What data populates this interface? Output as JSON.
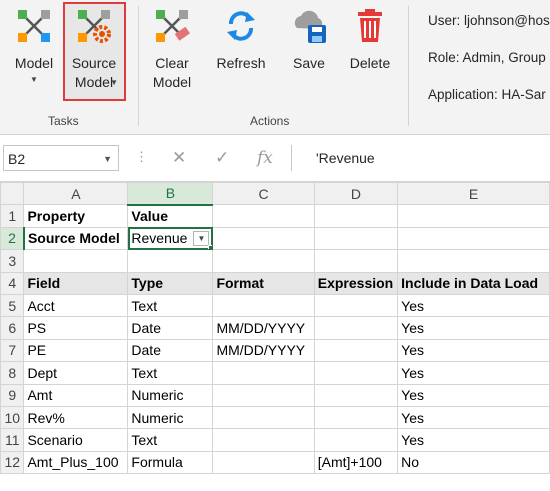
{
  "ribbon": {
    "buttons": [
      {
        "id": "model",
        "lines": [
          "Model"
        ],
        "caret": true
      },
      {
        "id": "source_model",
        "lines": [
          "Source",
          "Model"
        ],
        "caret": true
      },
      {
        "id": "clear_model",
        "lines": [
          "Clear",
          "Model"
        ],
        "caret": false
      },
      {
        "id": "refresh",
        "lines": [
          "Refresh"
        ],
        "caret": false
      },
      {
        "id": "save",
        "lines": [
          "Save"
        ],
        "caret": false
      },
      {
        "id": "delete",
        "lines": [
          "Delete"
        ],
        "caret": false
      }
    ],
    "groups": {
      "tasks": "Tasks",
      "actions": "Actions"
    },
    "info": {
      "user": "User: ljohnson@hos",
      "role": "Role: Admin, Group",
      "application": "Application: HA-Sar"
    },
    "colors": {
      "highlight": "#e0393e",
      "excel_green": "#217346"
    }
  },
  "formula_bar": {
    "cell_ref": "B2",
    "dots": "⋮",
    "cancel_glyph": "✕",
    "enter_glyph": "✓",
    "fx_label": "fx",
    "content": "'Revenue"
  },
  "sheet": {
    "columns": [
      "A",
      "B",
      "C",
      "D",
      "E"
    ],
    "selected_column": "B",
    "selected_row": "2",
    "rows": [
      {
        "n": "1",
        "cells": [
          "Property",
          "Value",
          "",
          "",
          ""
        ]
      },
      {
        "n": "2",
        "cells": [
          "Source Model",
          "Revenue",
          "",
          "",
          ""
        ]
      },
      {
        "n": "3",
        "cells": [
          "",
          "",
          "",
          "",
          ""
        ]
      },
      {
        "n": "4",
        "cells": [
          "Field",
          "Type",
          "Format",
          "Expression",
          "Include in Data Load"
        ]
      },
      {
        "n": "5",
        "cells": [
          "Acct",
          "Text",
          "",
          "",
          "Yes"
        ]
      },
      {
        "n": "6",
        "cells": [
          "PS",
          "Date",
          "MM/DD/YYYY",
          "",
          "Yes"
        ]
      },
      {
        "n": "7",
        "cells": [
          "PE",
          "Date",
          "MM/DD/YYYY",
          "",
          "Yes"
        ]
      },
      {
        "n": "8",
        "cells": [
          "Dept",
          "Text",
          "",
          "",
          "Yes"
        ]
      },
      {
        "n": "9",
        "cells": [
          "Amt",
          "Numeric",
          "",
          "",
          "Yes"
        ]
      },
      {
        "n": "10",
        "cells": [
          "Rev%",
          "Numeric",
          "",
          "",
          "Yes"
        ]
      },
      {
        "n": "11",
        "cells": [
          "Scenario",
          "Text",
          "",
          "",
          "Yes"
        ]
      },
      {
        "n": "12",
        "cells": [
          "Amt_Plus_100",
          "Formula",
          "",
          "[Amt]+100",
          "No"
        ]
      }
    ]
  }
}
